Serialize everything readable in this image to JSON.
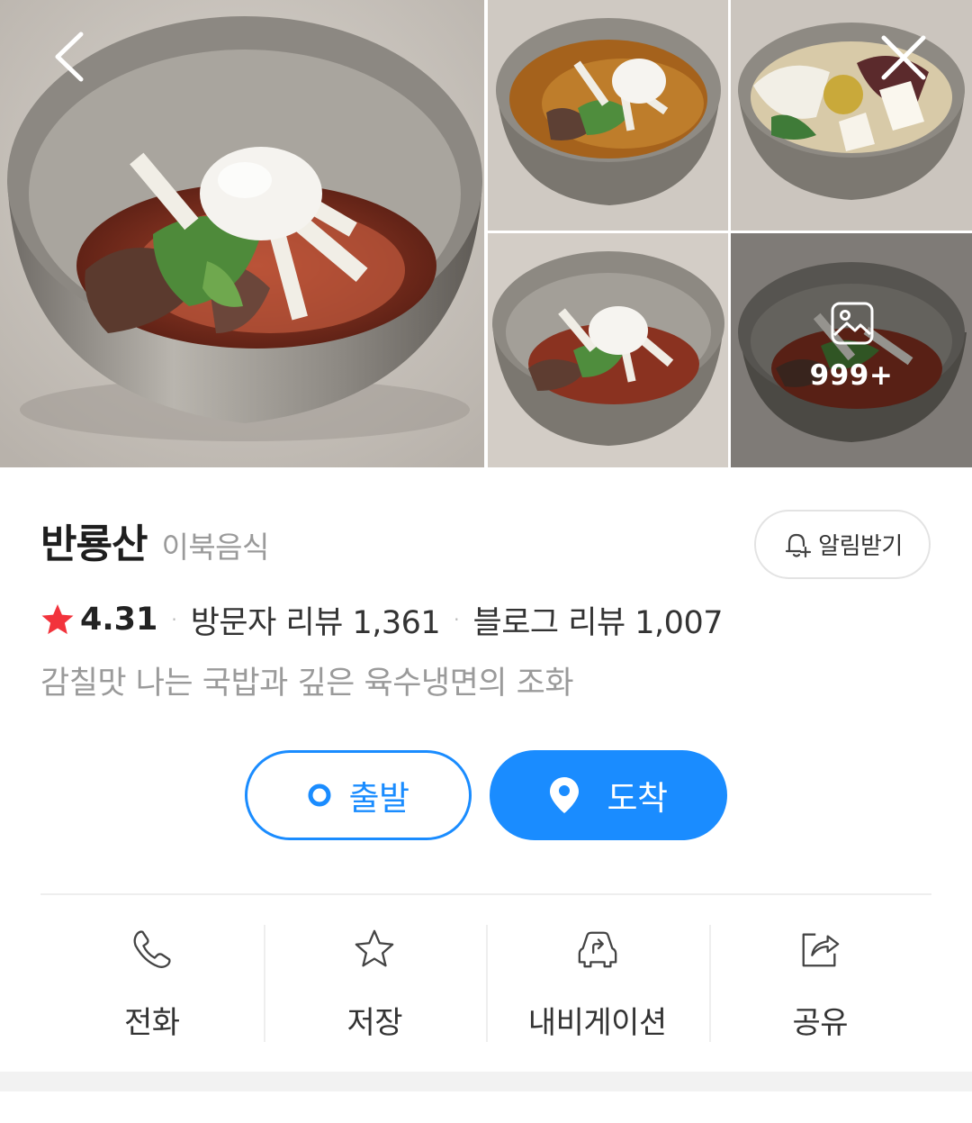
{
  "gallery": {
    "photo_count_label": "999+",
    "photos": [
      "bibim-naengmyeon-main",
      "mul-naengmyeon",
      "gukbap-with-radish",
      "bibim-naengmyeon",
      "bibim-naengmyeon-more"
    ]
  },
  "nav": {
    "back_icon": "chevron-left-icon",
    "close_icon": "close-icon"
  },
  "place": {
    "name": "반룡산",
    "category": "이북음식",
    "rating": "4.31",
    "visitor_reviews": "방문자 리뷰 1,361",
    "blog_reviews": "블로그 리뷰 1,007",
    "separator": "·",
    "description": "감칠맛 나는 국밥과 깊은 육수냉면의 조화"
  },
  "alert_button": {
    "label": "알림받기",
    "icon": "bell-plus-icon"
  },
  "route": {
    "depart_label": "출발",
    "arrive_label": "도착",
    "depart_icon": "origin-dot-icon",
    "arrive_icon": "location-pin-icon"
  },
  "actions": [
    {
      "label": "전화",
      "icon": "phone-icon"
    },
    {
      "label": "저장",
      "icon": "star-outline-icon"
    },
    {
      "label": "내비게이션",
      "icon": "car-navigation-icon"
    },
    {
      "label": "공유",
      "icon": "share-icon"
    }
  ],
  "colors": {
    "accent": "#1a8cff",
    "star": "#f2333c",
    "text_primary": "#1e1e1e",
    "text_secondary": "#9a9a9a",
    "divider": "#eeeeee"
  }
}
